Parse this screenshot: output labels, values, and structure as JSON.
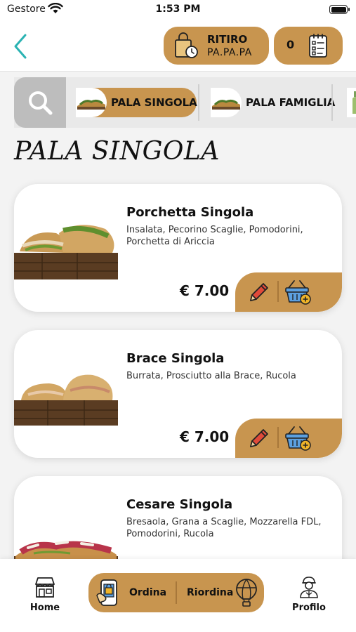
{
  "status_bar": {
    "carrier": "Gestore",
    "time": "1:53 PM"
  },
  "header": {
    "pickup": {
      "line1": "RITIRO",
      "line2": "PA.PA.PA"
    },
    "cart": {
      "count": "0"
    }
  },
  "categories": [
    {
      "label": "PALA SINGOLA",
      "active": true
    },
    {
      "label": "PALA FAMIGLIA",
      "active": false
    }
  ],
  "section_title": "PALA SINGOLA",
  "products": [
    {
      "name": "Porchetta Singola",
      "description": "Insalata, Pecorino Scaglie, Pomodorini, Porchetta di Ariccia",
      "price": "€ 7.00"
    },
    {
      "name": "Brace Singola",
      "description": "Burrata, Prosciutto alla Brace, Rucola",
      "price": "€ 7.00"
    },
    {
      "name": "Cesare Singola",
      "description": "Bresaola, Grana a Scaglie, Mozzarella FDL, Pomodorini, Rucola",
      "price": ""
    }
  ],
  "bottom_nav": {
    "home": "Home",
    "ordina": "Ordina",
    "riordina": "Riordina",
    "profile": "Profilo"
  },
  "colors": {
    "accent": "#c8954f",
    "back_arrow": "#2bb3b3"
  }
}
